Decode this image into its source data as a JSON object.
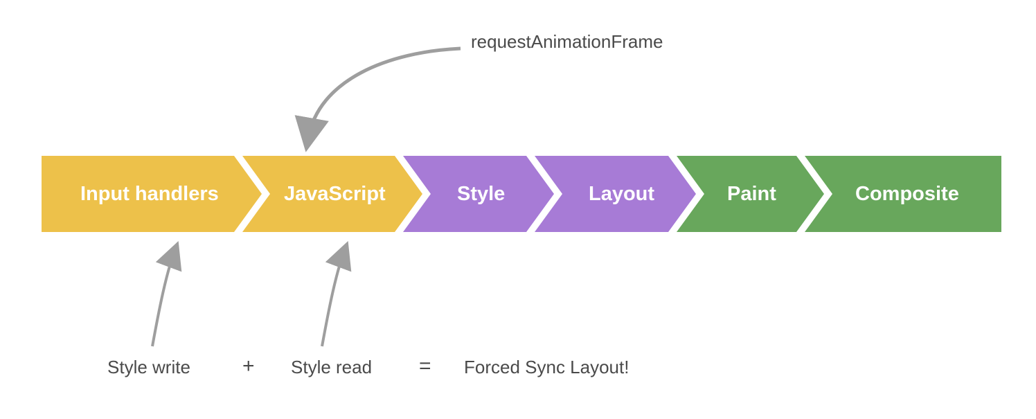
{
  "colors": {
    "yellow": "#edc14a",
    "purple": "#a77bd6",
    "green": "#68a75c",
    "arrow": "#9e9e9e",
    "text_dark": "#4a4a4a"
  },
  "pipeline": {
    "stages": [
      {
        "label": "Input handlers",
        "color": "yellow"
      },
      {
        "label": "JavaScript",
        "color": "yellow"
      },
      {
        "label": "Style",
        "color": "purple"
      },
      {
        "label": "Layout",
        "color": "purple"
      },
      {
        "label": "Paint",
        "color": "green"
      },
      {
        "label": "Composite",
        "color": "green"
      }
    ]
  },
  "annotations": {
    "top": "requestAnimationFrame",
    "bottom_left": "Style write",
    "bottom_mid": "Style read",
    "bottom_right": "Forced Sync Layout!",
    "plus": "+",
    "equals": "="
  }
}
